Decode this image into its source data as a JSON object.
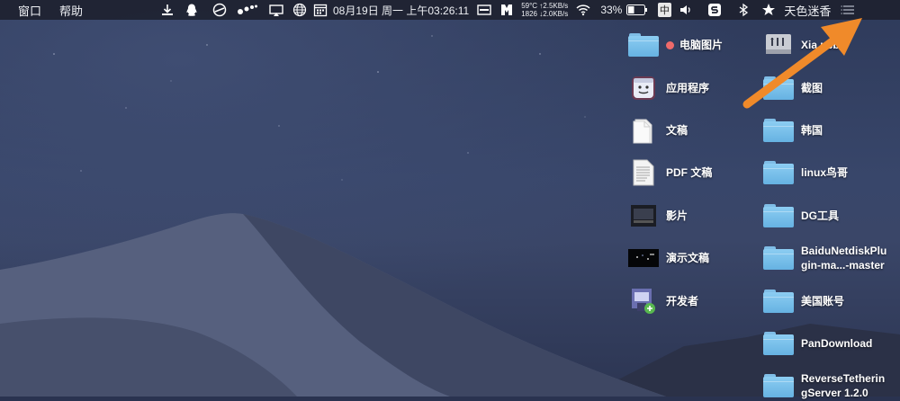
{
  "menubar": {
    "items": [
      "窗口",
      "帮助"
    ],
    "date_time": "08月19日 周一 上午03:26:11",
    "net_top": "59°C ↑2.5KB/s",
    "net_bottom": "1826 ↓2.0KB/s",
    "battery": "33%",
    "input_method": "中",
    "user_name": "天色迷香",
    "icons": [
      "download-icon",
      "qq-icon",
      "browser-icon",
      "dots-icon",
      "cast-icon",
      "globe-icon",
      "calendar-icon",
      "screen-icon",
      "logo-icon",
      "wifi-icon",
      "battery-icon",
      "volume-icon",
      "app-s-icon",
      "bluetooth-icon",
      "star-icon",
      "list-icon"
    ]
  },
  "desktop": {
    "left_column": [
      {
        "label": "电脑图片",
        "icon": "folder-icon",
        "tag": "red"
      },
      {
        "label": "应用程序",
        "icon": "applications-icon"
      },
      {
        "label": "文稿",
        "icon": "documents-icon"
      },
      {
        "label": "PDF 文稿",
        "icon": "pdf-document-icon"
      },
      {
        "label": "影片",
        "icon": "movies-icon"
      },
      {
        "label": "演示文稿",
        "icon": "presentation-icon"
      },
      {
        "label": "开发者",
        "icon": "developer-icon"
      }
    ],
    "right_column": [
      {
        "label": "Xia usb0",
        "icon": "usb-drive-icon"
      },
      {
        "label": "截图",
        "icon": "folder-icon"
      },
      {
        "label": "韩国",
        "icon": "folder-icon"
      },
      {
        "label": "linux鸟哥",
        "icon": "folder-icon"
      },
      {
        "label": "DG工具",
        "icon": "folder-icon"
      },
      {
        "label": "BaiduNetdiskPlugin-ma...-master",
        "line1": "BaiduNetdiskPlu",
        "line2": "gin-ma...-master",
        "icon": "folder-icon"
      },
      {
        "label": "美国账号",
        "icon": "folder-icon"
      },
      {
        "label": "PanDownload",
        "icon": "folder-icon"
      },
      {
        "label": "ReverseTetheringServer 1.2.0",
        "line1": "ReverseTetherin",
        "line2": "gServer 1.2.0",
        "icon": "folder-icon"
      }
    ]
  },
  "colors": {
    "menubar_bg": "#1e2230",
    "folder_blue": "#7cc2ec",
    "arrow_orange": "#f08a2a",
    "tag_red": "#ef6a6a"
  }
}
